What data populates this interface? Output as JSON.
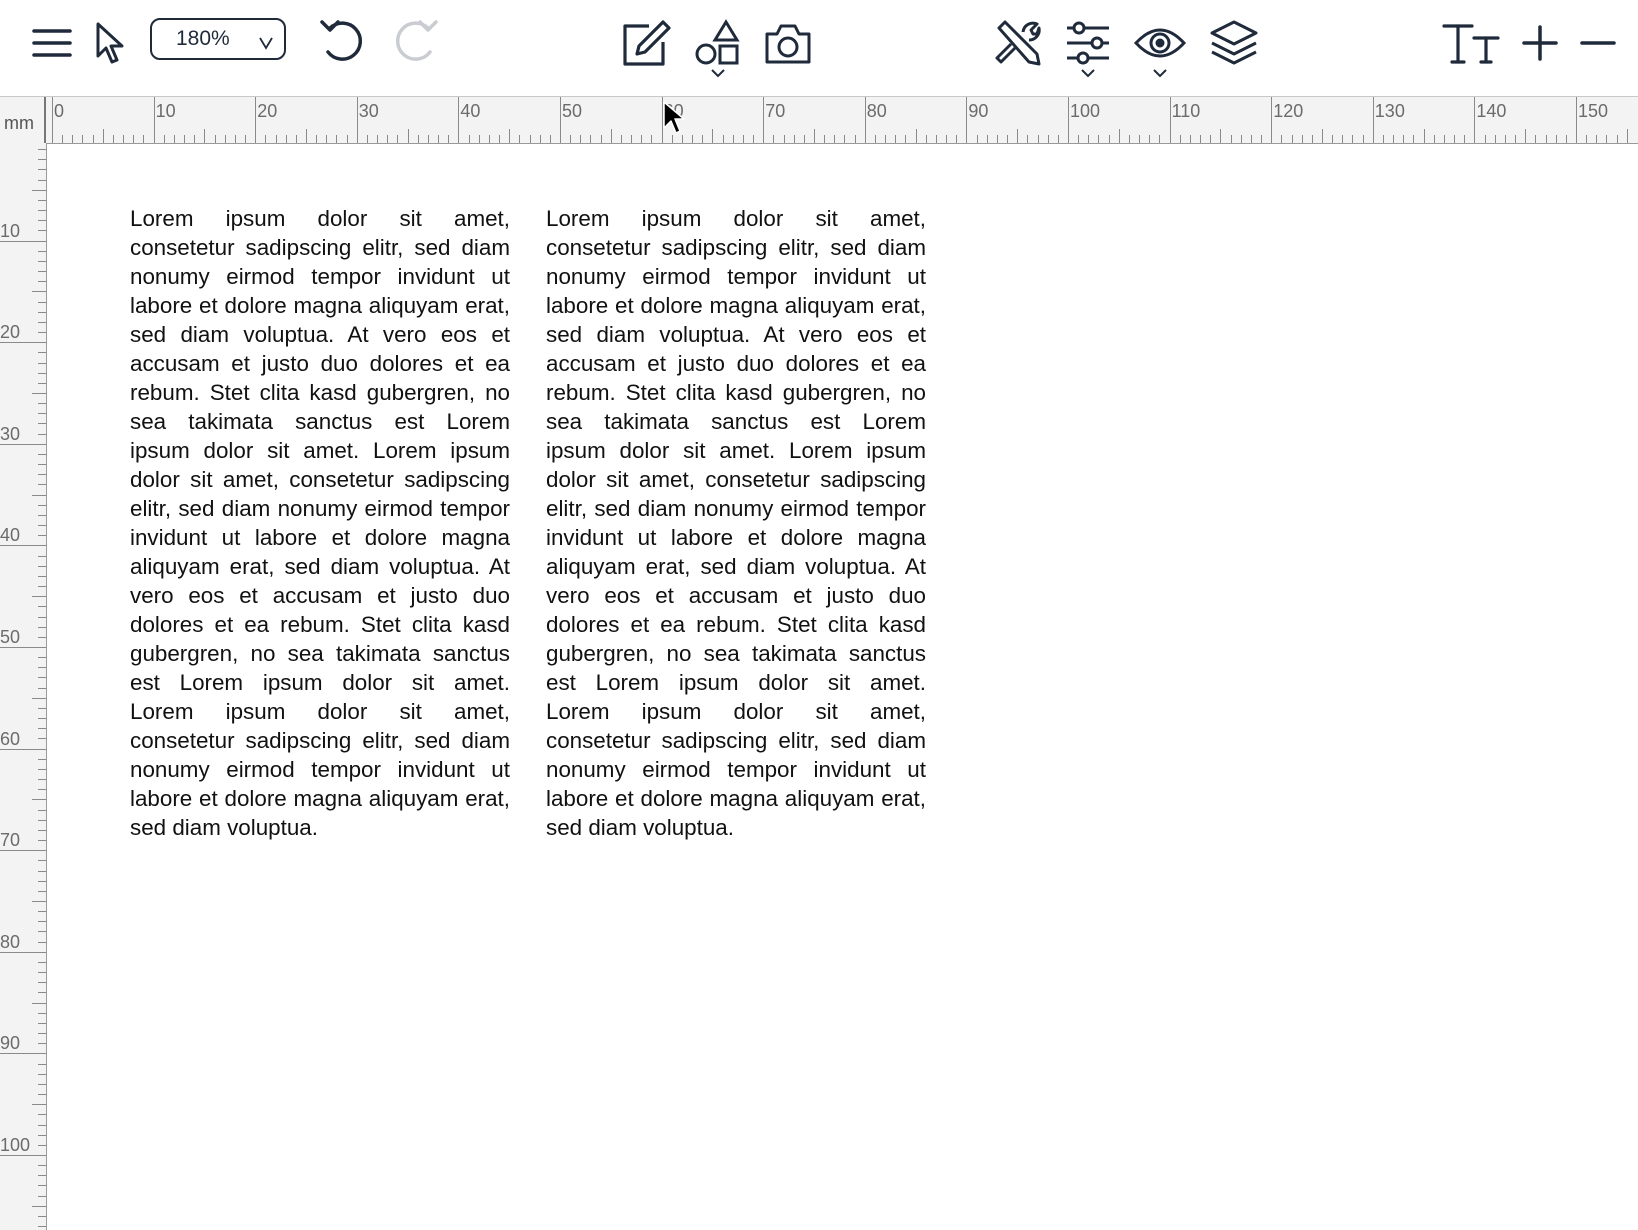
{
  "toolbar": {
    "zoom_value": "180%",
    "icons": [
      "menu-icon",
      "pointer-icon",
      "undo-icon",
      "redo-icon",
      "edit-icon",
      "shapes-icon",
      "camera-icon",
      "tools-icon",
      "sliders-icon",
      "eye-icon",
      "layers-icon",
      "text-size-icon",
      "plus-icon",
      "minus-icon"
    ]
  },
  "ruler": {
    "unit": "mm",
    "horizontal_labels": [
      "0",
      "10",
      "20",
      "30",
      "40",
      "50",
      "60",
      "70",
      "80",
      "90",
      "100",
      "110",
      "120",
      "130",
      "140",
      "150"
    ],
    "vertical_labels": [
      "10",
      "20",
      "30",
      "40",
      "50",
      "60",
      "70",
      "80",
      "90",
      "100"
    ]
  },
  "document": {
    "column1": "Lorem ipsum dolor sit amet, consetetur sadipscing elitr, sed diam nonumy eirmod tempor invidunt ut labore et dolore magna aliquyam erat, sed diam voluptua. At vero eos et accusam et justo duo dolores et ea rebum. Stet clita kasd gubergren, no sea takimata sanctus est Lorem ipsum dolor sit amet. Lorem ipsum dolor sit amet, consetetur sadipscing elitr, sed diam nonumy eirmod tempor invidunt ut labore et dolore magna aliquyam erat, sed diam voluptua. At vero eos et accusam et justo duo dolores et ea rebum. Stet clita kasd gubergren, no sea takimata sanctus est Lorem ipsum dolor sit amet. Lorem ipsum dolor sit amet, consetetur sadipscing elitr, sed diam nonumy eirmod tempor invidunt ut labore et dolore magna aliquyam erat, sed diam voluptua.",
    "column2": "Lorem ipsum dolor sit amet, consetetur sadipscing elitr, sed diam nonumy eirmod tempor invidunt ut labore et dolore magna aliquyam erat, sed diam voluptua. At vero eos et accusam et justo duo dolores et ea rebum. Stet clita kasd gubergren, no sea takimata sanctus est Lorem ipsum dolor sit amet. Lorem ipsum dolor sit amet, consetetur sadipscing elitr, sed diam nonumy eirmod tempor invidunt ut labore et dolore magna aliquyam erat, sed diam voluptua. At vero eos et accusam et justo duo dolores et ea rebum. Stet clita kasd gubergren, no sea takimata sanctus est Lorem ipsum dolor sit amet. Lorem ipsum dolor sit amet, consetetur sadipscing elitr, sed diam nonumy eirmod tempor invidunt ut labore et dolore magna aliquyam erat, sed diam voluptua."
  },
  "colors": {
    "icon": "#1f2a3a",
    "icon_disabled": "#c9ccd1",
    "ruler_bg": "#f3f3f3"
  }
}
